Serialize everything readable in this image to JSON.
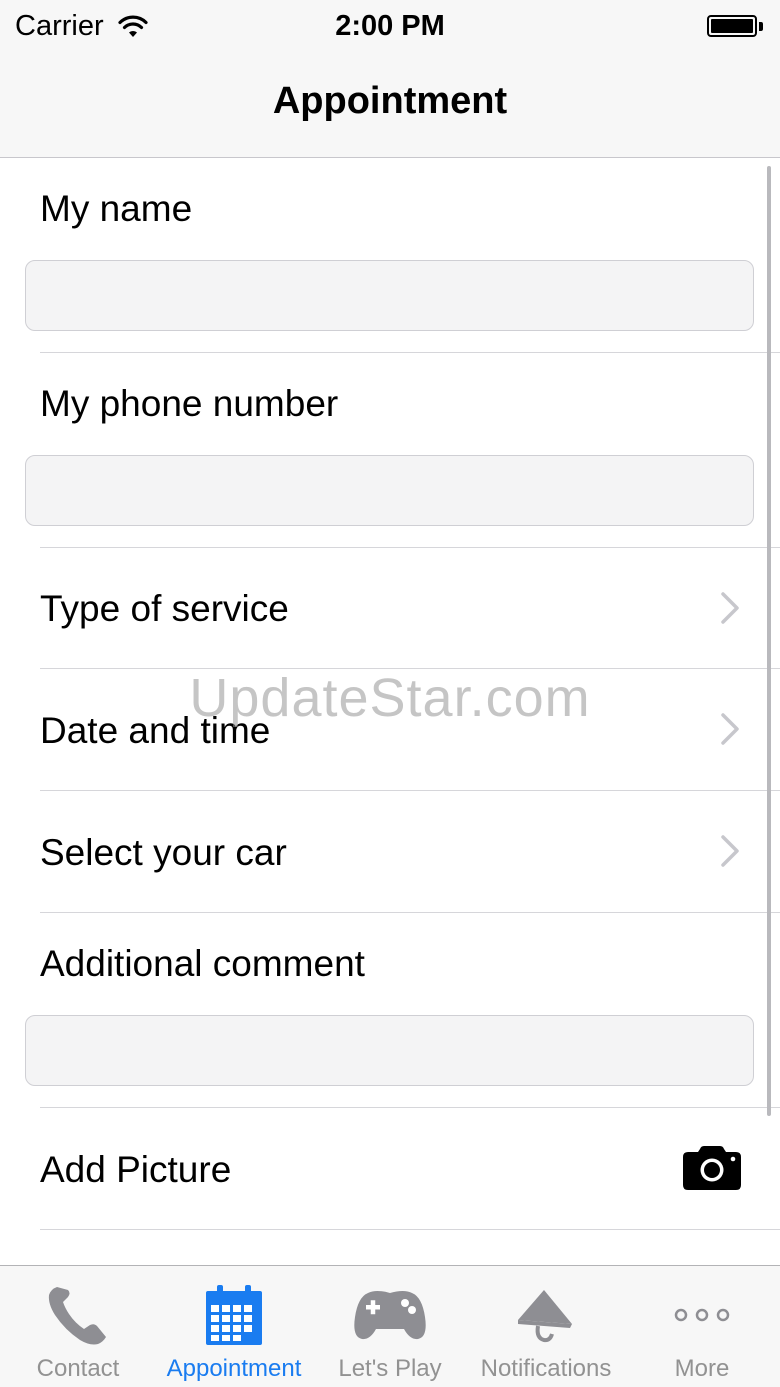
{
  "status_bar": {
    "carrier": "Carrier",
    "time": "2:00 PM",
    "icons": [
      "wifi-icon",
      "battery-icon"
    ]
  },
  "nav": {
    "title": "Appointment"
  },
  "form": {
    "name_label": "My name",
    "name_value": "",
    "phone_label": "My phone number",
    "phone_value": "",
    "service_label": "Type of service",
    "datetime_label": "Date and time",
    "car_label": "Select your car",
    "comment_label": "Additional comment",
    "comment_value": "",
    "picture_label": "Add Picture",
    "picture_icon": "camera-icon"
  },
  "watermark": "UpdateStar.com",
  "tabbar": {
    "tabs": [
      {
        "label": "Contact",
        "icon": "phone-icon",
        "active": false
      },
      {
        "label": "Appointment",
        "icon": "calendar-icon",
        "active": true
      },
      {
        "label": "Let's Play",
        "icon": "gamepad-icon",
        "active": false
      },
      {
        "label": "Notifications",
        "icon": "megaphone-icon",
        "active": false
      },
      {
        "label": "More",
        "icon": "more-icon",
        "active": false
      }
    ]
  },
  "colors": {
    "accent": "#1a7cf0",
    "inactive": "#929292",
    "bar_background": "#f7f7f7",
    "field_background": "#f4f4f5"
  }
}
